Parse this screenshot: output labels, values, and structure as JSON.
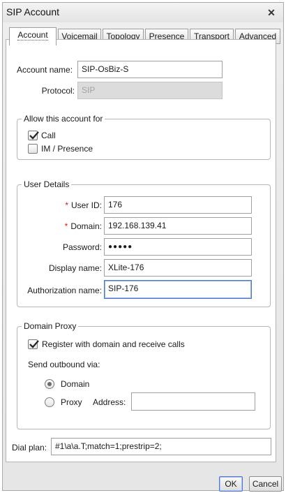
{
  "window": {
    "title": "SIP Account"
  },
  "tabs": [
    "Account",
    "Voicemail",
    "Topology",
    "Presence",
    "Transport",
    "Advanced"
  ],
  "account": {
    "name_label": "Account name:",
    "name_value": "SIP-OsBiz-S",
    "protocol_label": "Protocol:",
    "protocol_value": "SIP"
  },
  "allow": {
    "legend": "Allow this account for",
    "call_label": "Call",
    "call_checked": true,
    "im_label": "IM / Presence",
    "im_checked": false
  },
  "user_details": {
    "legend": "User Details",
    "required_marker": "*",
    "user_id_label": "User ID:",
    "user_id_value": "176",
    "domain_label": "Domain:",
    "domain_value": "192.168.139.41",
    "password_label": "Password:",
    "password_value": "●●●●●",
    "display_name_label": "Display name:",
    "display_name_value": "XLite-176",
    "auth_name_label": "Authorization name:",
    "auth_name_value": "SIP-176"
  },
  "domain_proxy": {
    "legend": "Domain Proxy",
    "register_label": "Register with domain and receive calls",
    "register_checked": true,
    "send_outbound_label": "Send outbound via:",
    "domain_option_label": "Domain",
    "proxy_option_label": "Proxy",
    "selected_option": "Domain",
    "address_label": "Address:",
    "address_value": ""
  },
  "dial_plan": {
    "label": "Dial plan:",
    "value": "#1\\a\\a.T;match=1;prestrip=2;"
  },
  "buttons": {
    "ok": "OK",
    "cancel": "Cancel"
  },
  "colors": {
    "required": "#d01818",
    "focus_border": "#4d78cc",
    "disabled_field": "#dcdcdc"
  }
}
